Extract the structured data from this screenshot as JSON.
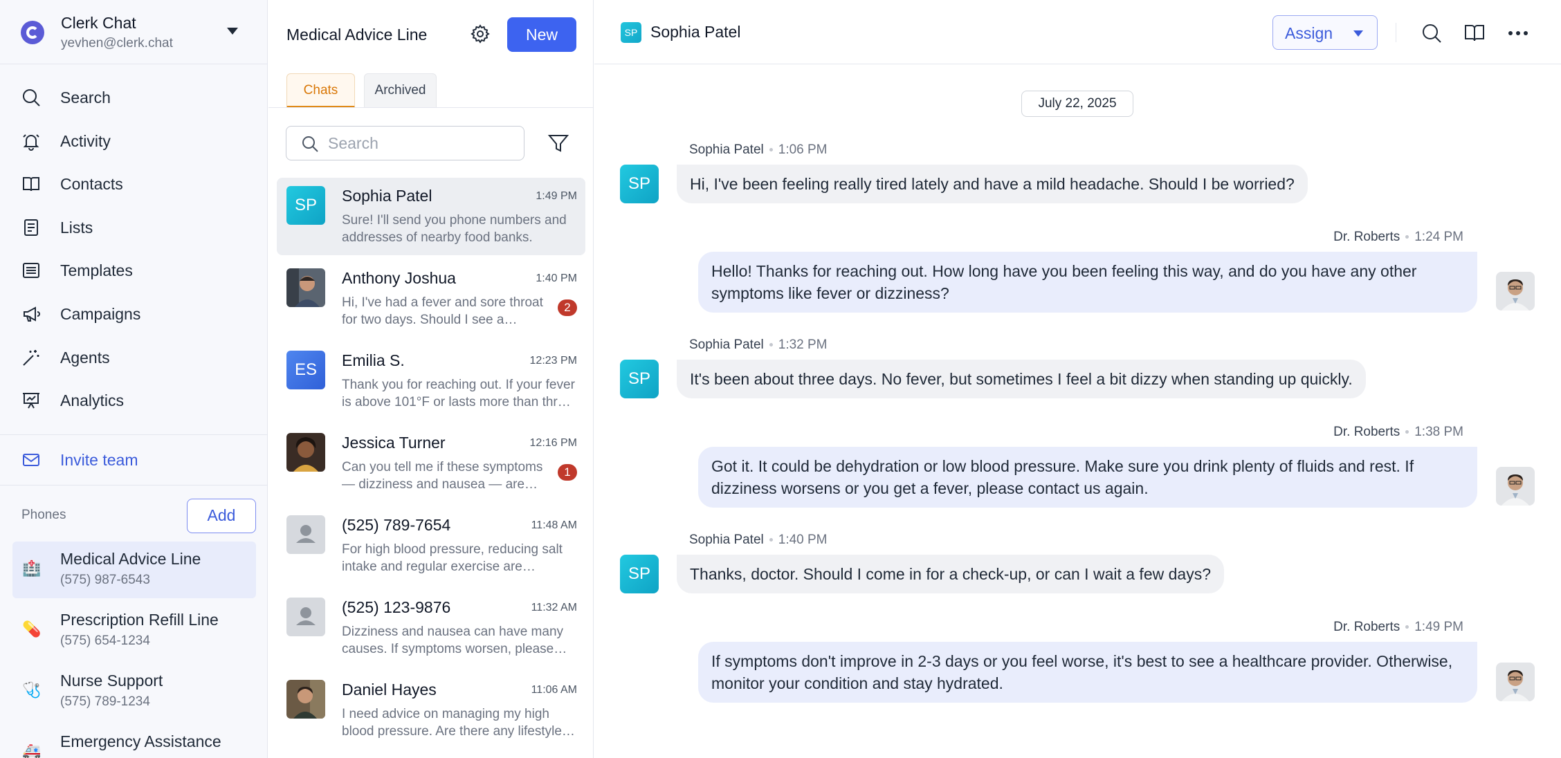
{
  "account": {
    "name": "Clerk Chat",
    "email": "yevhen@clerk.chat"
  },
  "nav": [
    {
      "label": "Search",
      "icon": "search-icon"
    },
    {
      "label": "Activity",
      "icon": "bell-icon"
    },
    {
      "label": "Contacts",
      "icon": "book-icon"
    },
    {
      "label": "Lists",
      "icon": "list-icon"
    },
    {
      "label": "Templates",
      "icon": "template-icon"
    },
    {
      "label": "Campaigns",
      "icon": "megaphone-icon"
    },
    {
      "label": "Agents",
      "icon": "magic-wand-icon"
    },
    {
      "label": "Analytics",
      "icon": "presentation-chart-icon"
    }
  ],
  "invite": {
    "label": "Invite team",
    "icon": "mail-icon"
  },
  "phones": {
    "label": "Phones",
    "add_label": "Add",
    "lines": [
      {
        "name": "Medical Advice Line",
        "number": "(575) 987-6543",
        "emoji": "🏥"
      },
      {
        "name": "Prescription Refill Line",
        "number": "(575) 654-1234",
        "emoji": "💊"
      },
      {
        "name": "Nurse Support",
        "number": "(575) 789-1234",
        "emoji": "🩺"
      },
      {
        "name": "Emergency Assistance",
        "number": "",
        "emoji": "🚑"
      }
    ]
  },
  "list": {
    "title": "Medical Advice Line",
    "new_label": "New",
    "tabs": {
      "chats": "Chats",
      "archived": "Archived"
    },
    "search_placeholder": "Search",
    "chats": [
      {
        "name": "Sophia Patel",
        "time": "1:49 PM",
        "preview": "Sure! I'll send you phone numbers and addresses of nearby food banks.",
        "initials": "SP",
        "badge": ""
      },
      {
        "name": "Anthony Joshua",
        "time": "1:40 PM",
        "preview": "Hi, I've had a fever and sore throat for two days. Should I see a doctor?",
        "initials": "",
        "badge": "2"
      },
      {
        "name": "Emilia S.",
        "time": "12:23 PM",
        "preview": "Thank you for reaching out. If your fever is above 101°F or lasts more than three days...",
        "initials": "ES",
        "badge": ""
      },
      {
        "name": "Jessica Turner",
        "time": "12:16 PM",
        "preview": "Can you tell me if these symptoms — dizziness and nausea — are serious?",
        "initials": "",
        "badge": "1"
      },
      {
        "name": "(525) 789-7654",
        "time": "11:48 AM",
        "preview": "For high blood pressure, reducing salt intake and regular exercise are important.",
        "initials": "",
        "badge": ""
      },
      {
        "name": "(525) 123-9876",
        "time": "11:32 AM",
        "preview": "Dizziness and nausea can have many causes. If symptoms worsen, please call us.",
        "initials": "",
        "badge": ""
      },
      {
        "name": "Daniel Hayes",
        "time": "11:06 AM",
        "preview": "I need advice on managing my high blood pressure. Are there any lifestyle changes?",
        "initials": "",
        "badge": ""
      }
    ]
  },
  "conversation": {
    "contact_name": "Sophia Patel",
    "contact_initials": "SP",
    "assign_label": "Assign",
    "date": "July 22, 2025",
    "messages": [
      {
        "sender": "Sophia Patel",
        "time": "1:06 PM",
        "text": "Hi, I've been feeling really tired lately and have a mild headache. Should I be worried?"
      },
      {
        "sender": "Dr. Roberts",
        "time": "1:24 PM",
        "text": "Hello! Thanks for reaching out. How long have you been feeling this way, and do you have any other symptoms like fever or dizziness?"
      },
      {
        "sender": "Sophia Patel",
        "time": "1:32 PM",
        "text": "It's been about three days. No fever, but sometimes I feel a bit dizzy when standing up quickly."
      },
      {
        "sender": "Dr. Roberts",
        "time": "1:38 PM",
        "text": "Got it. It could be dehydration or low blood pressure. Make sure you drink plenty of fluids and rest. If dizziness worsens or you get a fever, please contact us again."
      },
      {
        "sender": "Sophia Patel",
        "time": "1:40 PM",
        "text": "Thanks, doctor. Should I come in for a check-up, or can I wait a few days?"
      },
      {
        "sender": "Dr. Roberts",
        "time": "1:49 PM",
        "text": "If symptoms don't improve in 2-3 days or you feel worse, it's best to see a healthcare provider. Otherwise, monitor your condition and stay hydrated."
      }
    ]
  },
  "colors": {
    "accent": "#3d63f0",
    "tab_active": "#e08a18",
    "badge": "#c0392b",
    "avatar_cyan": "#12a7c9",
    "avatar_blue": "#3b6fe0"
  }
}
